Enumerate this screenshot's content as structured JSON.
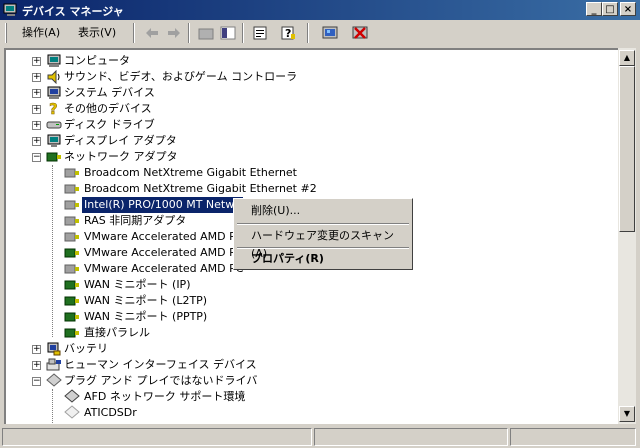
{
  "window": {
    "title": "デバイス マネージャ"
  },
  "toolbar": {
    "action_menu": "操作(A)",
    "view_menu": "表示(V)"
  },
  "tree": {
    "categories_top": [
      "コンピュータ",
      "サウンド、ビデオ、およびゲーム コントローラ",
      "システム デバイス",
      "その他のデバイス",
      "ディスク ドライブ",
      "ディスプレイ アダプタ",
      "ネットワーク アダプタ"
    ],
    "network_children": [
      "Broadcom NetXtreme Gigabit Ethernet",
      "Broadcom NetXtreme Gigabit Ethernet #2",
      "Intel(R) PRO/1000 MT Netwo",
      "RAS 非同期アダプタ",
      "VMware Accelerated AMD PC",
      "VMware Accelerated AMD PC",
      "VMware Accelerated AMD PC",
      "WAN ミニポート (IP)",
      "WAN ミニポート (L2TP)",
      "WAN ミニポート (PPTP)",
      "直接パラレル"
    ],
    "categories_bottom": [
      "バッテリ",
      "ヒューマン インターフェイス デバイス",
      "プラグ アンド プレイではないドライバ"
    ],
    "pnp_children": [
      "AFD ネットワーク サポート環境",
      "ATICDSDr"
    ]
  },
  "context_menu": {
    "delete": "削除(U)...",
    "scan": "ハードウェア変更のスキャン(A)",
    "properties": "プロパティ(R)"
  },
  "colors": {
    "title_bar": "#0a246a",
    "selection": "#0a246a",
    "chrome": "#d4d0c8"
  }
}
